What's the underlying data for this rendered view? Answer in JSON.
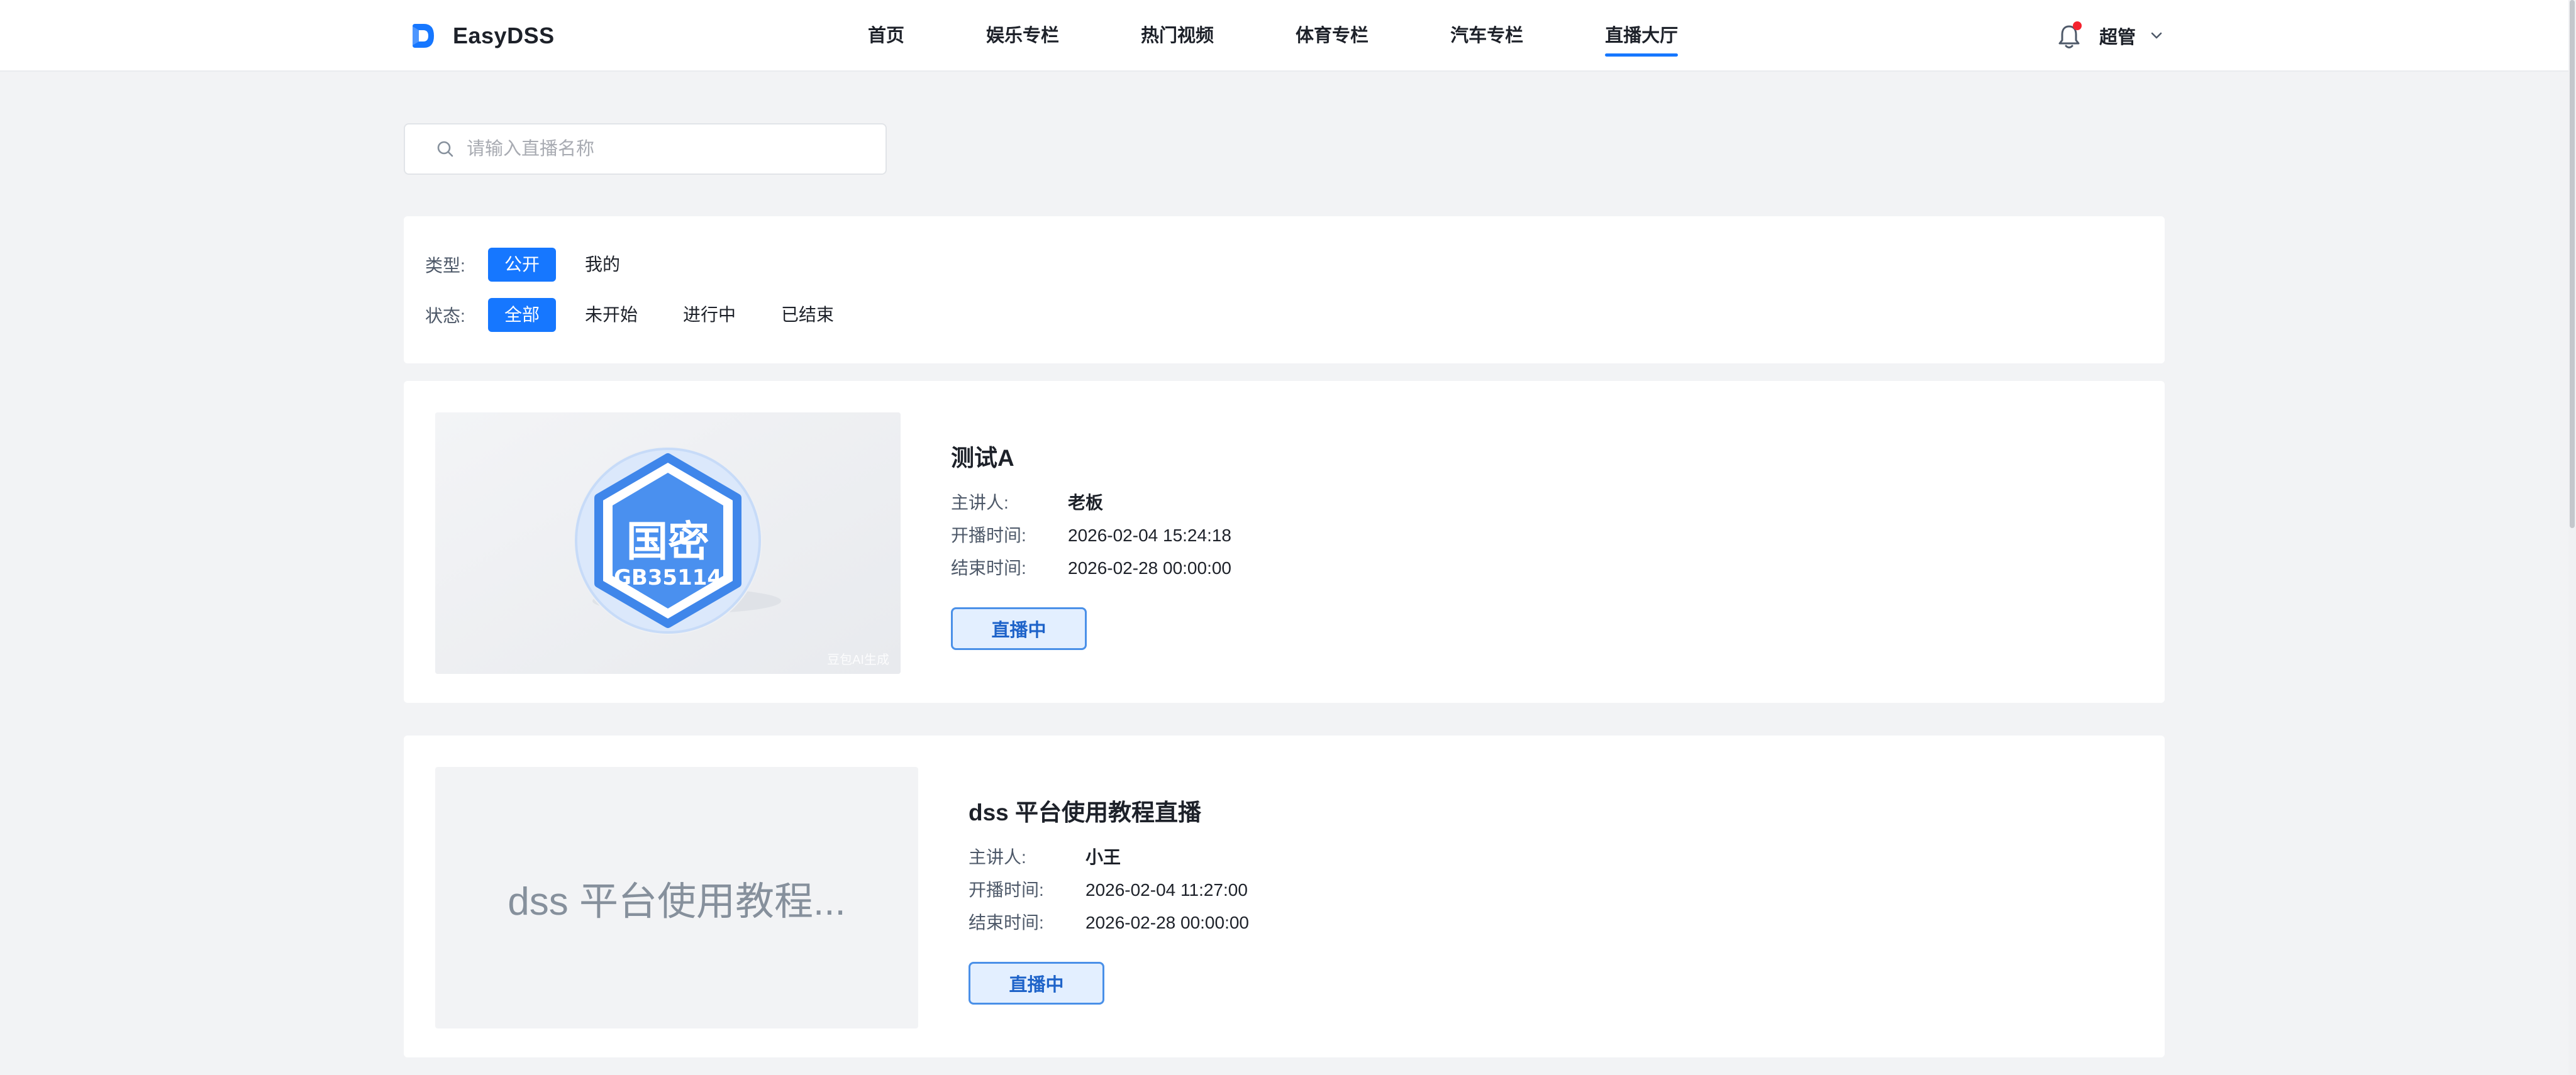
{
  "header": {
    "brand": "EasyDSS",
    "nav": [
      {
        "label": "首页"
      },
      {
        "label": "娱乐专栏"
      },
      {
        "label": "热门视频"
      },
      {
        "label": "体育专栏"
      },
      {
        "label": "汽车专栏"
      },
      {
        "label": "直播大厅",
        "active": true
      }
    ],
    "user": "超管",
    "accent_color": "#1677ff",
    "notification_dot_color": "#f5222d"
  },
  "search": {
    "placeholder": "请输入直播名称",
    "value": ""
  },
  "filters": {
    "type_label": "类型:",
    "type_options": [
      {
        "label": "公开",
        "selected": true
      },
      {
        "label": "我的",
        "selected": false
      }
    ],
    "status_label": "状态:",
    "status_options": [
      {
        "label": "全部",
        "selected": true
      },
      {
        "label": "未开始",
        "selected": false
      },
      {
        "label": "进行中",
        "selected": false
      },
      {
        "label": "已结束",
        "selected": false
      }
    ]
  },
  "lives": [
    {
      "title": "测试A",
      "thumbnail": {
        "kind": "image",
        "badge_top": "国密",
        "badge_bottom": "GB35114",
        "watermark": "豆包AI生成"
      },
      "host_label": "主讲人:",
      "host": "老板",
      "start_label": "开播时间:",
      "start": "2026-02-04 15:24:18",
      "end_label": "结束时间:",
      "end": "2026-02-28 00:00:00",
      "status": "直播中"
    },
    {
      "title": "dss 平台使用教程直播",
      "thumbnail": {
        "kind": "text",
        "text": "dss 平台使用教程..."
      },
      "host_label": "主讲人:",
      "host": "小王",
      "start_label": "开播时间:",
      "start": "2026-02-04 11:27:00",
      "end_label": "结束时间:",
      "end": "2026-02-28 00:00:00",
      "status": "直播中"
    }
  ]
}
